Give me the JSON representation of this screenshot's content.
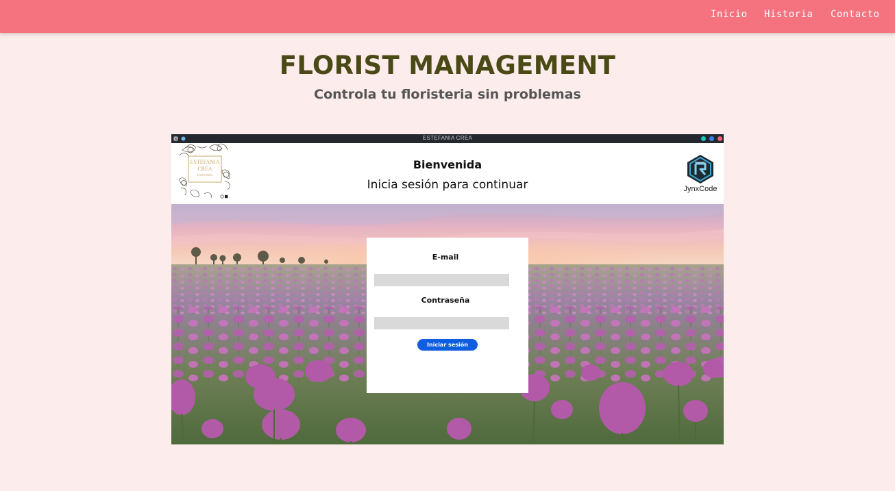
{
  "nav": {
    "links": [
      "Inicio",
      "Historia",
      "Contacto"
    ]
  },
  "hero": {
    "title": "FLORIST MANAGEMENT",
    "subtitle": "Controla tu floristeria sin problemas"
  },
  "app_window": {
    "title": "ESTEFANIA CREA",
    "controls": [
      "minimize-button",
      "maximize-button",
      "close-button"
    ],
    "header": {
      "welcome": "Bienvenida",
      "subtitle": "Inicia sesión para continuar",
      "brand_logo_lines": [
        "ESTEFANIA",
        "CREA",
        "FLORISTERIA"
      ],
      "partner_logo_text": "JynxCode"
    },
    "login": {
      "email_label": "E-mail",
      "email_value": "",
      "password_label": "Contraseña",
      "password_value": "",
      "submit_label": "Iniciar sesión"
    }
  },
  "colors": {
    "navbar": "#f5727f",
    "page_background": "#fdecec",
    "title": "#4a4a16",
    "subtitle": "#555555",
    "login_button": "#0f5de0"
  }
}
